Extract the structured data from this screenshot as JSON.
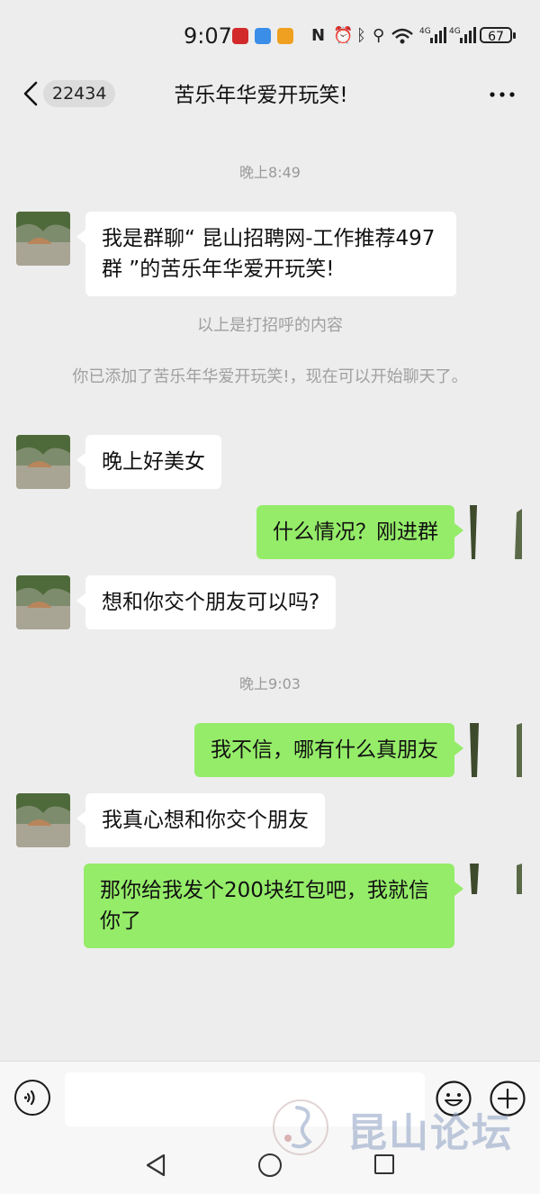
{
  "status_bar": {
    "time": "9:07",
    "battery": "67",
    "icons": [
      "nfc-icon",
      "alarm-icon",
      "bluetooth-icon",
      "location-icon",
      "wifi-icon",
      "signal-4g-icon",
      "signal-4g-icon"
    ],
    "network_label": "4G"
  },
  "header": {
    "unread_count": "22434",
    "title": "苦乐年华爱开玩笑!"
  },
  "messages": {
    "ts1": "晚上8:49",
    "m1": "我是群聊“ 昆山招聘网-工作推荐497群 ”的苦乐年华爱开玩笑!",
    "sys1": "以上是打招呼的内容",
    "sys2": "你已添加了苦乐年华爱开玩笑!，现在可以开始聊天了。",
    "m2": "晚上好美女",
    "m3": "什么情况？刚进群",
    "m4": "想和你交个朋友可以吗?",
    "ts2": "晚上9:03",
    "m5": "我不信，哪有什么真朋友",
    "m6": "我真心想和你交个朋友",
    "m7": "那你给我发个200块红包吧，我就信你了"
  },
  "watermark": {
    "text": "昆山论坛"
  },
  "colors": {
    "background": "#ededed",
    "outgoing_bubble": "#95ec69",
    "incoming_bubble": "#ffffff",
    "timestamp": "#9a9a9a"
  }
}
